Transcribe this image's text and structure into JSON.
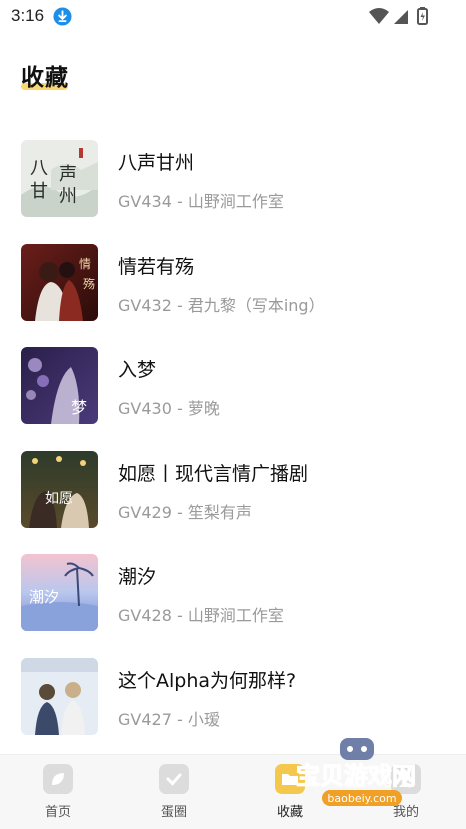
{
  "status": {
    "time": "3:16"
  },
  "page": {
    "title": "收藏"
  },
  "items": [
    {
      "title": "八声甘州",
      "subtitle": "GV434 - 山野涧工作室",
      "cover_text": "八声甘州"
    },
    {
      "title": "情若有殇",
      "subtitle": "GV432 - 君九黎（写本ing）",
      "cover_text": "情若有殇"
    },
    {
      "title": "入梦",
      "subtitle": "GV430 - 萝晚",
      "cover_text": "入梦"
    },
    {
      "title": "如愿丨现代言情广播剧",
      "subtitle": "GV429 - 笙梨有声",
      "cover_text": "如愿"
    },
    {
      "title": "潮汐",
      "subtitle": "GV428 - 山野涧工作室",
      "cover_text": "潮汐"
    },
    {
      "title": "这个Alpha为何那样?",
      "subtitle": "GV427 - 小瑷",
      "cover_text": ""
    }
  ],
  "tabs": [
    {
      "label": "首页",
      "icon": "leaf-icon"
    },
    {
      "label": "蛋圈",
      "icon": "check-icon"
    },
    {
      "label": "收藏",
      "icon": "folder-icon",
      "active": true
    },
    {
      "label": "我的",
      "icon": "user-icon"
    }
  ],
  "watermark": {
    "text": "宝贝游戏网",
    "url": "baobeiy.com"
  },
  "colors": {
    "accent": "#f8d773",
    "subtitle": "#9a9a9a",
    "tabbar_bg": "#f7f7f7"
  }
}
